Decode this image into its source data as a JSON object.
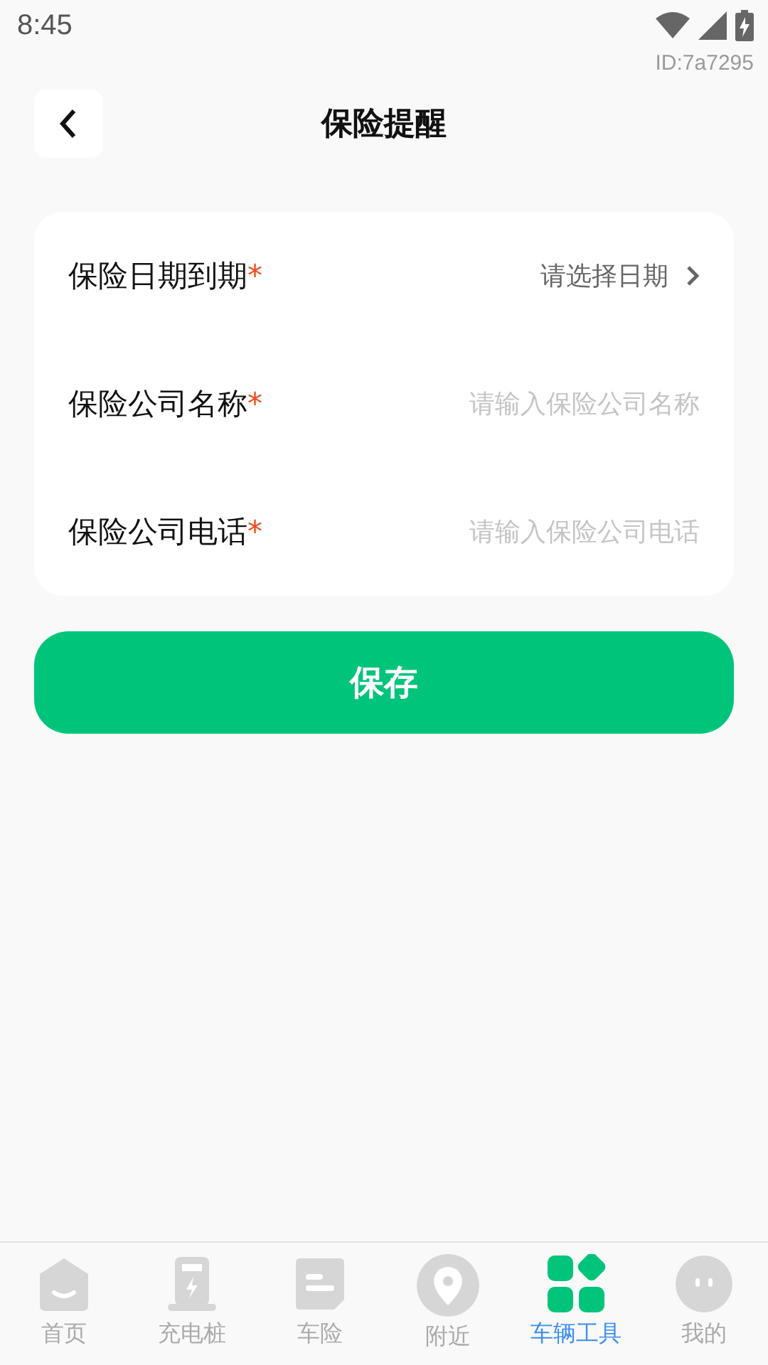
{
  "status_bar": {
    "time": "8:45"
  },
  "device_id": "ID:7a7295",
  "header": {
    "title": "保险提醒"
  },
  "form": [
    {
      "kind": "select",
      "label": "保险日期到期",
      "required_mark": "*",
      "value": "请选择日期"
    },
    {
      "kind": "input",
      "label": "保险公司名称",
      "required_mark": "*",
      "placeholder": "请输入保险公司名称"
    },
    {
      "kind": "input",
      "label": "保险公司电话",
      "required_mark": "*",
      "placeholder": "请输入保险公司电话"
    }
  ],
  "save_button": "保存",
  "tabs": [
    {
      "kind": "home",
      "label": "首页",
      "selected": false
    },
    {
      "kind": "charger",
      "label": "充电桩",
      "selected": false
    },
    {
      "kind": "insurance",
      "label": "车险",
      "selected": false
    },
    {
      "kind": "nearby",
      "label": "附近",
      "selected": false
    },
    {
      "kind": "tools",
      "label": "车辆工具",
      "selected": true
    },
    {
      "kind": "me",
      "label": "我的",
      "selected": false
    }
  ]
}
